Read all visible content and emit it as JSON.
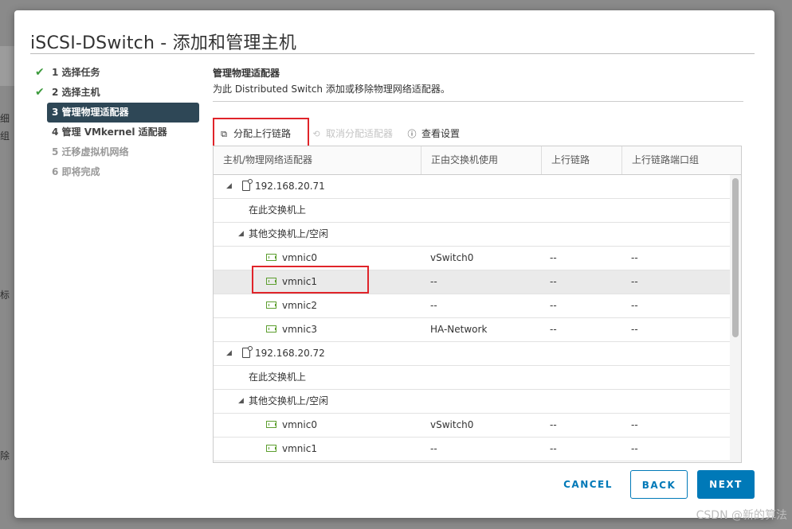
{
  "dialog": {
    "title": "iSCSI-DSwitch - 添加和管理主机"
  },
  "steps": [
    {
      "label": "1 选择任务",
      "state": "done"
    },
    {
      "label": "2 选择主机",
      "state": "done"
    },
    {
      "label": "3 管理物理适配器",
      "state": "active"
    },
    {
      "label": "4 管理 VMkernel 适配器",
      "state": "pending"
    },
    {
      "label": "5 迁移虚拟机网络",
      "state": "disabled"
    },
    {
      "label": "6 即将完成",
      "state": "disabled"
    }
  ],
  "section": {
    "title": "管理物理适配器",
    "description": "为此 Distributed Switch 添加或移除物理网络适配器。"
  },
  "toolbar": {
    "assign_label": "分配上行链路",
    "unassign_label": "取消分配适配器",
    "view_label": "查看设置"
  },
  "grid": {
    "columns": [
      "主机/物理网络适配器",
      "正由交换机使用",
      "上行链路",
      "上行链路端口组"
    ],
    "rows": [
      {
        "type": "host",
        "name": "192.168.20.71",
        "switch": "",
        "uplink": "",
        "portgroup": ""
      },
      {
        "type": "group",
        "name": "在此交换机上",
        "switch": "",
        "uplink": "",
        "portgroup": ""
      },
      {
        "type": "group-expanded",
        "name": "其他交换机上/空闲",
        "switch": "",
        "uplink": "",
        "portgroup": ""
      },
      {
        "type": "nic",
        "name": "vmnic0",
        "switch": "vSwitch0",
        "uplink": "--",
        "portgroup": "--"
      },
      {
        "type": "nic",
        "name": "vmnic1",
        "switch": "--",
        "uplink": "--",
        "portgroup": "--",
        "selected": true
      },
      {
        "type": "nic",
        "name": "vmnic2",
        "switch": "--",
        "uplink": "--",
        "portgroup": "--"
      },
      {
        "type": "nic",
        "name": "vmnic3",
        "switch": "HA-Network",
        "uplink": "--",
        "portgroup": "--"
      },
      {
        "type": "host",
        "name": "192.168.20.72",
        "switch": "",
        "uplink": "",
        "portgroup": ""
      },
      {
        "type": "group",
        "name": "在此交换机上",
        "switch": "",
        "uplink": "",
        "portgroup": ""
      },
      {
        "type": "group-expanded",
        "name": "其他交换机上/空闲",
        "switch": "",
        "uplink": "",
        "portgroup": ""
      },
      {
        "type": "nic",
        "name": "vmnic0",
        "switch": "vSwitch0",
        "uplink": "--",
        "portgroup": "--"
      },
      {
        "type": "nic",
        "name": "vmnic1",
        "switch": "--",
        "uplink": "--",
        "portgroup": "--"
      }
    ]
  },
  "buttons": {
    "cancel": "CANCEL",
    "back": "BACK",
    "next": "NEXT"
  },
  "background_fragments": [
    "细",
    "组",
    "标",
    "除"
  ],
  "watermark": "CSDN @新的算法",
  "colors": {
    "accent": "#0079b8",
    "active_step": "#2e4756",
    "check": "#3c9a3c",
    "highlight_box": "#e0242a"
  }
}
